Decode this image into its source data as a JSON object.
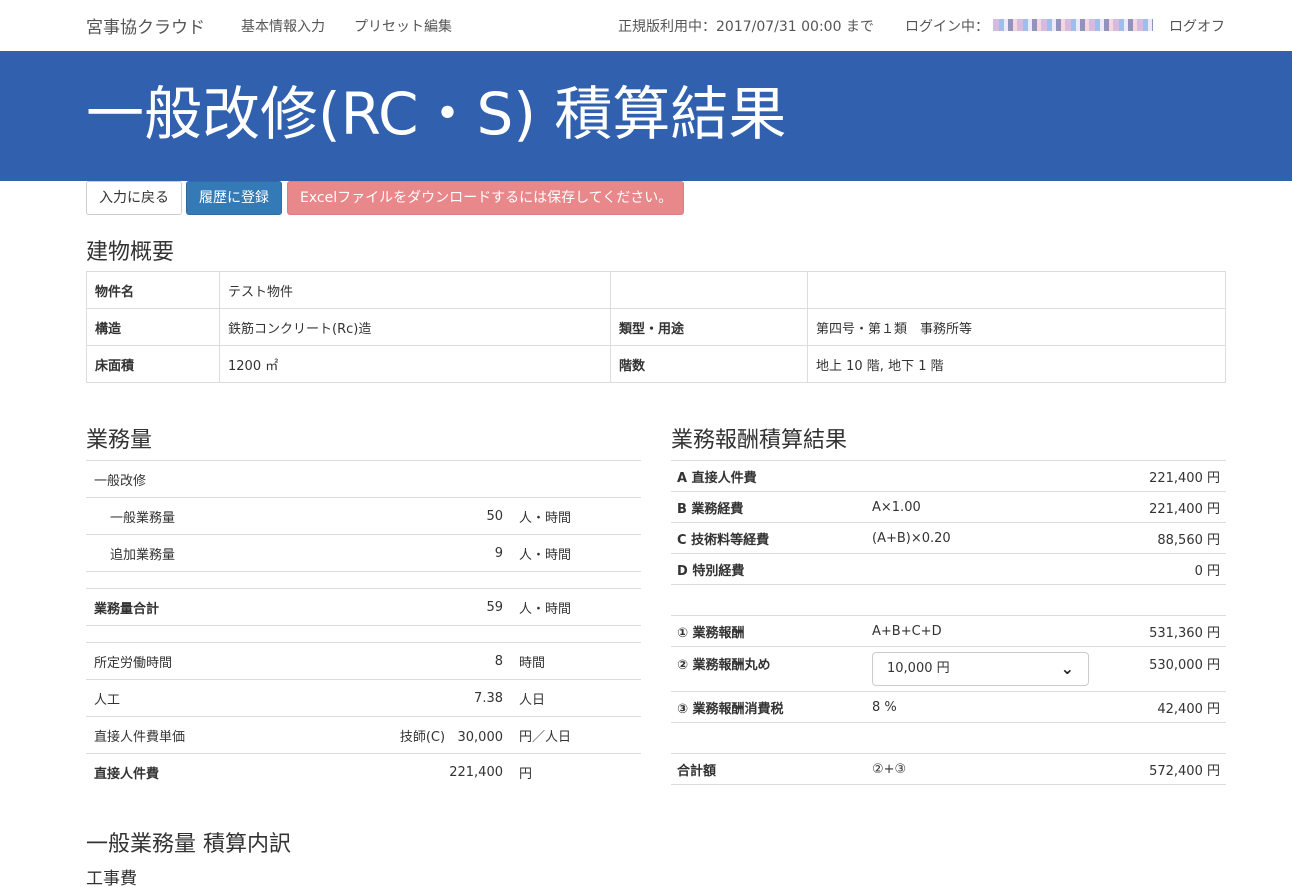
{
  "nav": {
    "brand": "宮事協クラウド",
    "links": [
      "基本情報入力",
      "プリセット編集"
    ],
    "license": "正規版利用中：2017/07/31 00:00 まで",
    "login_label": "ログイン中：",
    "logoff": "ログオフ"
  },
  "header": {
    "title": "一般改修(RC・S) 積算結果"
  },
  "buttons": {
    "back": "入力に戻る",
    "register": "履歴に登録",
    "excel_notice": "Excelファイルをダウンロードするには保存してください。"
  },
  "overview": {
    "heading": "建物概要",
    "rows": [
      [
        "物件名",
        "テスト物件",
        "",
        ""
      ],
      [
        "構造",
        "鉄筋コンクリート(Rc)造",
        "類型・用途",
        "第四号・第１類　事務所等"
      ],
      [
        "床面積",
        "1200 ㎡",
        "階数",
        "地上 10 階, 地下 1 階"
      ]
    ]
  },
  "workload": {
    "heading": "業務量",
    "category": "一般改修",
    "rows": [
      {
        "label": "一般業務量",
        "value": "50",
        "unit": "人・時間"
      },
      {
        "label": "追加業務量",
        "value": "9",
        "unit": "人・時間"
      }
    ],
    "total": {
      "label": "業務量合計",
      "value": "59",
      "unit": "人・時間"
    },
    "hours": {
      "label": "所定労働時間",
      "value": "8",
      "unit": "時間"
    },
    "manday": {
      "label": "人工",
      "value": "7.38",
      "unit": "人日"
    },
    "unit_price": {
      "label": "直接人件費単価",
      "grade": "技師(C)",
      "value": "30,000",
      "unit": "円／人日"
    },
    "direct": {
      "label": "直接人件費",
      "value": "221,400",
      "unit": "円"
    }
  },
  "fee": {
    "heading": "業務報酬積算結果",
    "items": [
      {
        "label": "A 直接人件費",
        "formula": "",
        "amount": "221,400 円"
      },
      {
        "label": "B 業務経費",
        "formula": "A×1.00",
        "amount": "221,400 円"
      },
      {
        "label": "C 技術料等経費",
        "formula": "(A+B)×0.20",
        "amount": "88,560 円"
      },
      {
        "label": "D 特別経費",
        "formula": "",
        "amount": "0 円"
      }
    ],
    "reward": {
      "label": "① 業務報酬",
      "formula": "A+B+C+D",
      "amount": "531,360 円"
    },
    "rounded": {
      "label": "② 業務報酬丸め",
      "select_value": "10,000 円",
      "amount": "530,000 円"
    },
    "tax": {
      "label": "③ 業務報酬消費税",
      "formula": "8 %",
      "amount": "42,400 円"
    },
    "total": {
      "label": "合計額",
      "formula": "②+③",
      "amount": "572,400 円"
    }
  },
  "breakdown": {
    "heading": "一般業務量 積算内訳",
    "subheading": "工事費"
  }
}
